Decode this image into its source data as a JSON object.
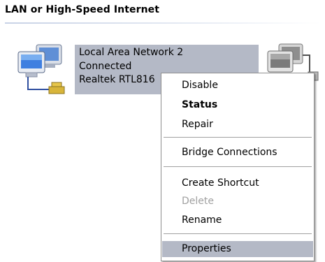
{
  "section": {
    "title": "LAN or High-Speed Internet"
  },
  "connection": {
    "name": "Local Area Network 2",
    "status": "Connected",
    "adapter": "Realtek RTL816"
  },
  "context_menu": {
    "disable": "Disable",
    "status": "Status",
    "repair": "Repair",
    "bridge_connections": "Bridge Connections",
    "create_shortcut": "Create Shortcut",
    "delete": "Delete",
    "rename": "Rename",
    "properties": "Properties"
  },
  "colors": {
    "selection": "#b4b9c6",
    "menu_border": "#8f8f8f",
    "disabled_text": "#a0a0a0"
  },
  "icons": {
    "connection_1": "network-connection-icon",
    "connection_2": "network-connection-icon-gray"
  }
}
